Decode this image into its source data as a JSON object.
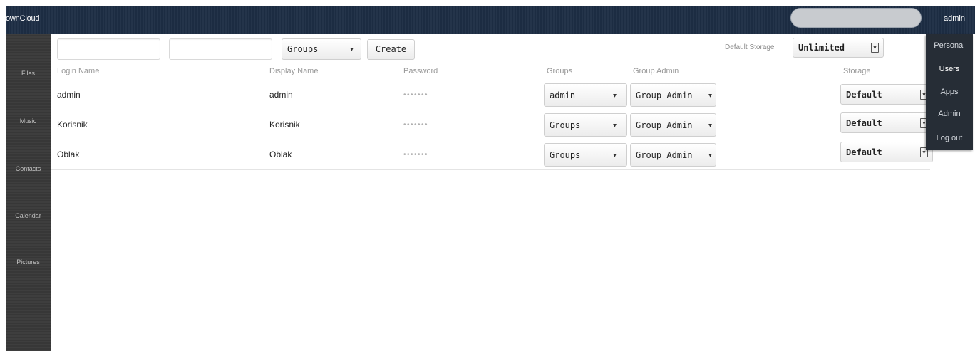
{
  "header": {
    "logo_text": "ownCloud",
    "user_name": "admin"
  },
  "nav": {
    "items": [
      {
        "label": "Files"
      },
      {
        "label": "Music"
      },
      {
        "label": "Contacts"
      },
      {
        "label": "Calendar"
      },
      {
        "label": "Pictures"
      }
    ]
  },
  "settings_menu": {
    "items": [
      {
        "label": "Personal"
      },
      {
        "label": "Users"
      },
      {
        "label": "Apps"
      },
      {
        "label": "Admin"
      },
      {
        "label": "Log out"
      }
    ],
    "active": "Users"
  },
  "controls": {
    "login_input_value": "",
    "password_input_value": "",
    "groups_select": "Groups",
    "create_label": "Create",
    "default_storage_label": "Default Storage",
    "default_storage_value": "Unlimited"
  },
  "table": {
    "headers": {
      "login_name": "Login Name",
      "display_name": "Display Name",
      "password": "Password",
      "groups": "Groups",
      "group_admin": "Group Admin",
      "storage": "Storage"
    },
    "rows": [
      {
        "login": "admin",
        "display": "admin",
        "password": "•••••••",
        "groups": "admin",
        "group_admin": "Group Admin",
        "storage": "Default"
      },
      {
        "login": "Korisnik",
        "display": "Korisnik",
        "password": "•••••••",
        "groups": "Groups",
        "group_admin": "Group Admin",
        "storage": "Default"
      },
      {
        "login": "Oblak",
        "display": "Oblak",
        "password": "•••••••",
        "groups": "Groups",
        "group_admin": "Group Admin",
        "storage": "Default"
      }
    ]
  },
  "icons": {
    "select_arrow": "chevron-down-icon",
    "storage_arrow": "select-arrow-icon"
  },
  "colors": {
    "header_bg": "#1d2d44",
    "nav_bg": "#393939",
    "menu_bg": "#262d36"
  }
}
